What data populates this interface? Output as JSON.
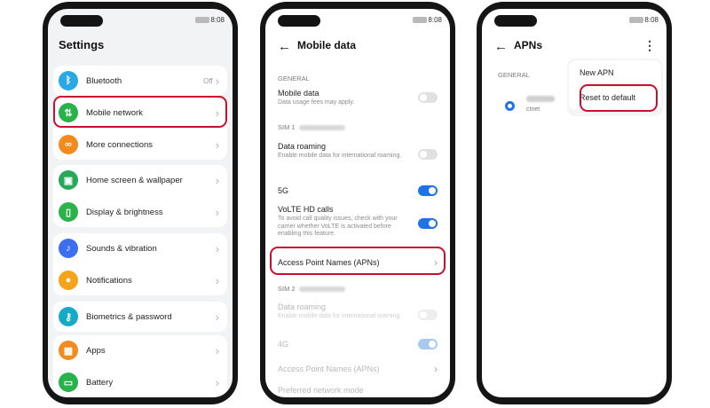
{
  "time": "8:08",
  "settings": {
    "title": "Settings",
    "items": [
      {
        "label": "Bluetooth",
        "value": "Off",
        "icon": "bluetooth-icon",
        "color": "#2aa8e6"
      },
      {
        "label": "Mobile network",
        "value": "",
        "icon": "mobile-network-icon",
        "color": "#27b34a"
      },
      {
        "label": "More connections",
        "value": "",
        "icon": "link-icon",
        "color": "#f28a1d"
      },
      {
        "label": "Home screen & wallpaper",
        "value": "",
        "icon": "wallpaper-icon",
        "color": "#27a85b"
      },
      {
        "label": "Display & brightness",
        "value": "",
        "icon": "display-icon",
        "color": "#2bb34a"
      },
      {
        "label": "Sounds & vibration",
        "value": "",
        "icon": "sound-icon",
        "color": "#3b6ff0"
      },
      {
        "label": "Notifications",
        "value": "",
        "icon": "bell-icon",
        "color": "#f5a41a"
      },
      {
        "label": "Biometrics & password",
        "value": "",
        "icon": "key-icon",
        "color": "#17a9c8"
      },
      {
        "label": "Apps",
        "value": "",
        "icon": "apps-icon",
        "color": "#f28a1d"
      },
      {
        "label": "Battery",
        "value": "",
        "icon": "battery-icon",
        "color": "#27b34a"
      }
    ]
  },
  "mobile_data": {
    "title": "Mobile data",
    "general_header": "GENERAL",
    "mobile_data": {
      "title": "Mobile data",
      "sub": "Data usage fees may apply.",
      "on": false
    },
    "sim1_header": "SIM 1",
    "data_roaming": {
      "title": "Data roaming",
      "sub": "Enable mobile data for international roaming.",
      "on": false
    },
    "fiveg": {
      "title": "5G",
      "on": true
    },
    "volte": {
      "title": "VoLTE HD calls",
      "sub": "To avoid call quality issues, check with your carrier whether VoLTE is activated before enabling this feature.",
      "on": true
    },
    "apn": {
      "title": "Access Point Names (APNs)"
    },
    "sim2_header": "SIM 2",
    "data_roaming2": {
      "title": "Data roaming",
      "sub": "Enable mobile data for international roaming.",
      "on": false
    },
    "fourg": {
      "title": "4G",
      "on": true
    },
    "apn2": {
      "title": "Access Point Names (APNs)"
    },
    "preferred": {
      "title": "Preferred network mode"
    }
  },
  "apns": {
    "title": "APNs",
    "general_header": "GENERAL",
    "apn_sub": "ctnet",
    "menu": [
      "New APN",
      "Reset to default"
    ]
  }
}
